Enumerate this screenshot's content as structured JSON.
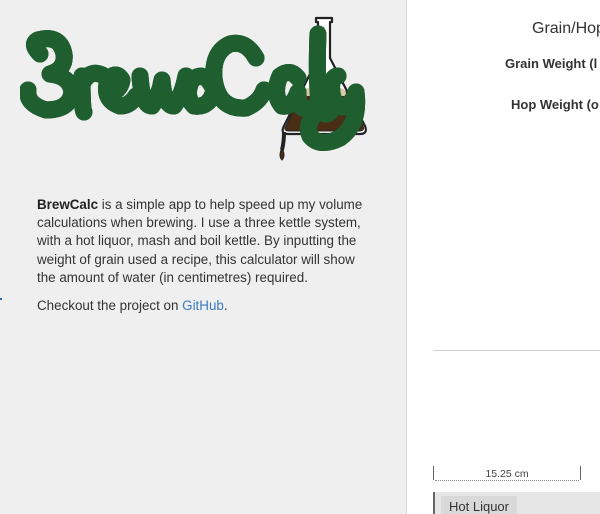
{
  "logo": {
    "text": "BrewCalc"
  },
  "intro": {
    "brand": "BrewCalc",
    "text": " is a simple app to help speed up my volume calculations when brewing. I use a three kettle system, with a hot liquor, mash and boil kettle. By inputting the weight of grain used a recipe, this calculator will show the amount of water (in centimetres) required."
  },
  "github": {
    "prefix": "Checkout the project on ",
    "link_text": "GitHub",
    "suffix": "."
  },
  "calculator": {
    "heading": "Grain/Hop",
    "grain_label": "Grain Weight (l",
    "hop_label": "Hop Weight (o"
  },
  "measurement": {
    "label": "15.25 cm"
  },
  "kettle": {
    "label": "Hot Liquor"
  },
  "colors": {
    "left_panel_bg": "#efefef",
    "logo_green": "#3fa35a",
    "link_blue": "#3a7bbf"
  }
}
